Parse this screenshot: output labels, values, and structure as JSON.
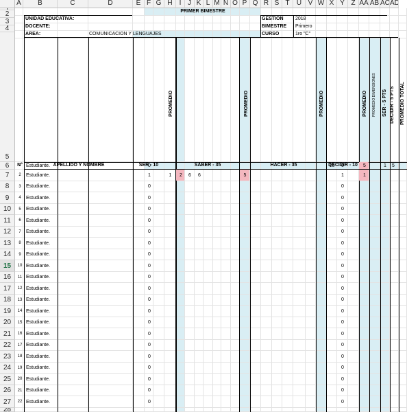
{
  "grid": {
    "columns": [
      "A",
      "B",
      "C",
      "D",
      "E",
      "F",
      "G",
      "H",
      "I",
      "J",
      "K",
      "L",
      "M",
      "N",
      "O",
      "P",
      "Q",
      "R",
      "S",
      "T",
      "U",
      "V",
      "W",
      "X",
      "Y",
      "Z",
      "AA",
      "AB",
      "AC",
      "AD"
    ],
    "row_numbers": [
      "1",
      "2",
      "3",
      "4",
      "5",
      "6",
      "7",
      "8",
      "9",
      "10",
      "11",
      "12",
      "13",
      "14",
      "15",
      "16",
      "17",
      "18",
      "19",
      "20",
      "21",
      "22",
      "23",
      "24",
      "25",
      "26",
      "27",
      "28"
    ],
    "selected_row": "15"
  },
  "sheet": {
    "title": "PRIMER BIMESTRE",
    "unidad_label": "UNIDAD EDUCATIVA:",
    "docente_label": "DOCENTE:",
    "area_label": "AREA:",
    "area_value": "COMUNICACION Y LENGUAJES",
    "gestion_label": "GESTION",
    "gestion_value": "2018",
    "bimestre_label": "BIMESTRE",
    "bimestre_value": "Primero",
    "curso_label": "CURSO",
    "curso_value": "1ro \"C\"",
    "promedio_label": "PROMEDIO",
    "promedio_dimensiones": "PROMEDIO DIMENSIONES",
    "ser5": "SER - 5 PTS",
    "decidir5": "DECIDIR - 5 PTS",
    "promedio_total": "PROMEDIO TOTAL",
    "n_header": "N°",
    "apellido_header": "APELLIDO Y NOMBRE",
    "ser_header": "SER - 10",
    "saber_header": "SABER - 35",
    "hacer_header": "HACER - 35",
    "decidir_header": "DECIDIR - 10"
  },
  "students": [
    {
      "n": "1",
      "name": "Estudiante.",
      "ser": "0",
      "h_prom": "",
      "saber": [
        "",
        "",
        ""
      ],
      "o_prom": "",
      "decidir_w": "10",
      "decidir_x": "0",
      "prom_z": "5",
      "ab": "1",
      "ac": "5"
    },
    {
      "n": "2",
      "name": "Estudiante.",
      "ser": "1",
      "h_prom": "1",
      "saber": [
        "2",
        "6",
        "6"
      ],
      "o_prom": "5",
      "decidir_w": "",
      "decidir_x": "1",
      "prom_z": "1",
      "ab": "",
      "ac": ""
    },
    {
      "n": "3",
      "name": "Estudiante.",
      "ser": "0",
      "decidir_x": "0"
    },
    {
      "n": "4",
      "name": "Estudiante.",
      "ser": "0",
      "decidir_x": "0"
    },
    {
      "n": "5",
      "name": "Estudiante.",
      "ser": "0",
      "decidir_x": "0"
    },
    {
      "n": "6",
      "name": "Estudiante.",
      "ser": "0",
      "decidir_x": "0"
    },
    {
      "n": "7",
      "name": "Estudiante.",
      "ser": "0",
      "decidir_x": "0"
    },
    {
      "n": "8",
      "name": "Estudiante.",
      "ser": "0",
      "decidir_x": "0"
    },
    {
      "n": "9",
      "name": "Estudiante.",
      "ser": "0",
      "decidir_x": "0"
    },
    {
      "n": "10",
      "name": "Estudiante.",
      "ser": "0",
      "decidir_x": "0"
    },
    {
      "n": "11",
      "name": "Estudiante.",
      "ser": "0",
      "decidir_x": "0"
    },
    {
      "n": "12",
      "name": "Estudiante.",
      "ser": "0",
      "decidir_x": "0"
    },
    {
      "n": "13",
      "name": "Estudiante.",
      "ser": "0",
      "decidir_x": "0"
    },
    {
      "n": "14",
      "name": "Estudiante.",
      "ser": "0",
      "decidir_x": "0"
    },
    {
      "n": "15",
      "name": "Estudiante.",
      "ser": "0",
      "decidir_x": "0"
    },
    {
      "n": "16",
      "name": "Estudiante.",
      "ser": "0",
      "decidir_x": "0"
    },
    {
      "n": "17",
      "name": "Estudiante.",
      "ser": "0",
      "decidir_x": "0"
    },
    {
      "n": "18",
      "name": "Estudiante.",
      "ser": "0",
      "decidir_x": "0"
    },
    {
      "n": "19",
      "name": "Estudiante.",
      "ser": "0",
      "decidir_x": "0"
    },
    {
      "n": "20",
      "name": "Estudiante.",
      "ser": "0",
      "decidir_x": "0"
    },
    {
      "n": "21",
      "name": "Estudiante.",
      "ser": "0",
      "decidir_x": "0"
    },
    {
      "n": "22",
      "name": "Estudiante.",
      "ser": "0",
      "decidir_x": "0"
    }
  ],
  "colors": {
    "header_bg": "#f2f2f2",
    "shade": "#d9eef4",
    "pink": "#f4b7bf",
    "selected_row": "#217346"
  }
}
